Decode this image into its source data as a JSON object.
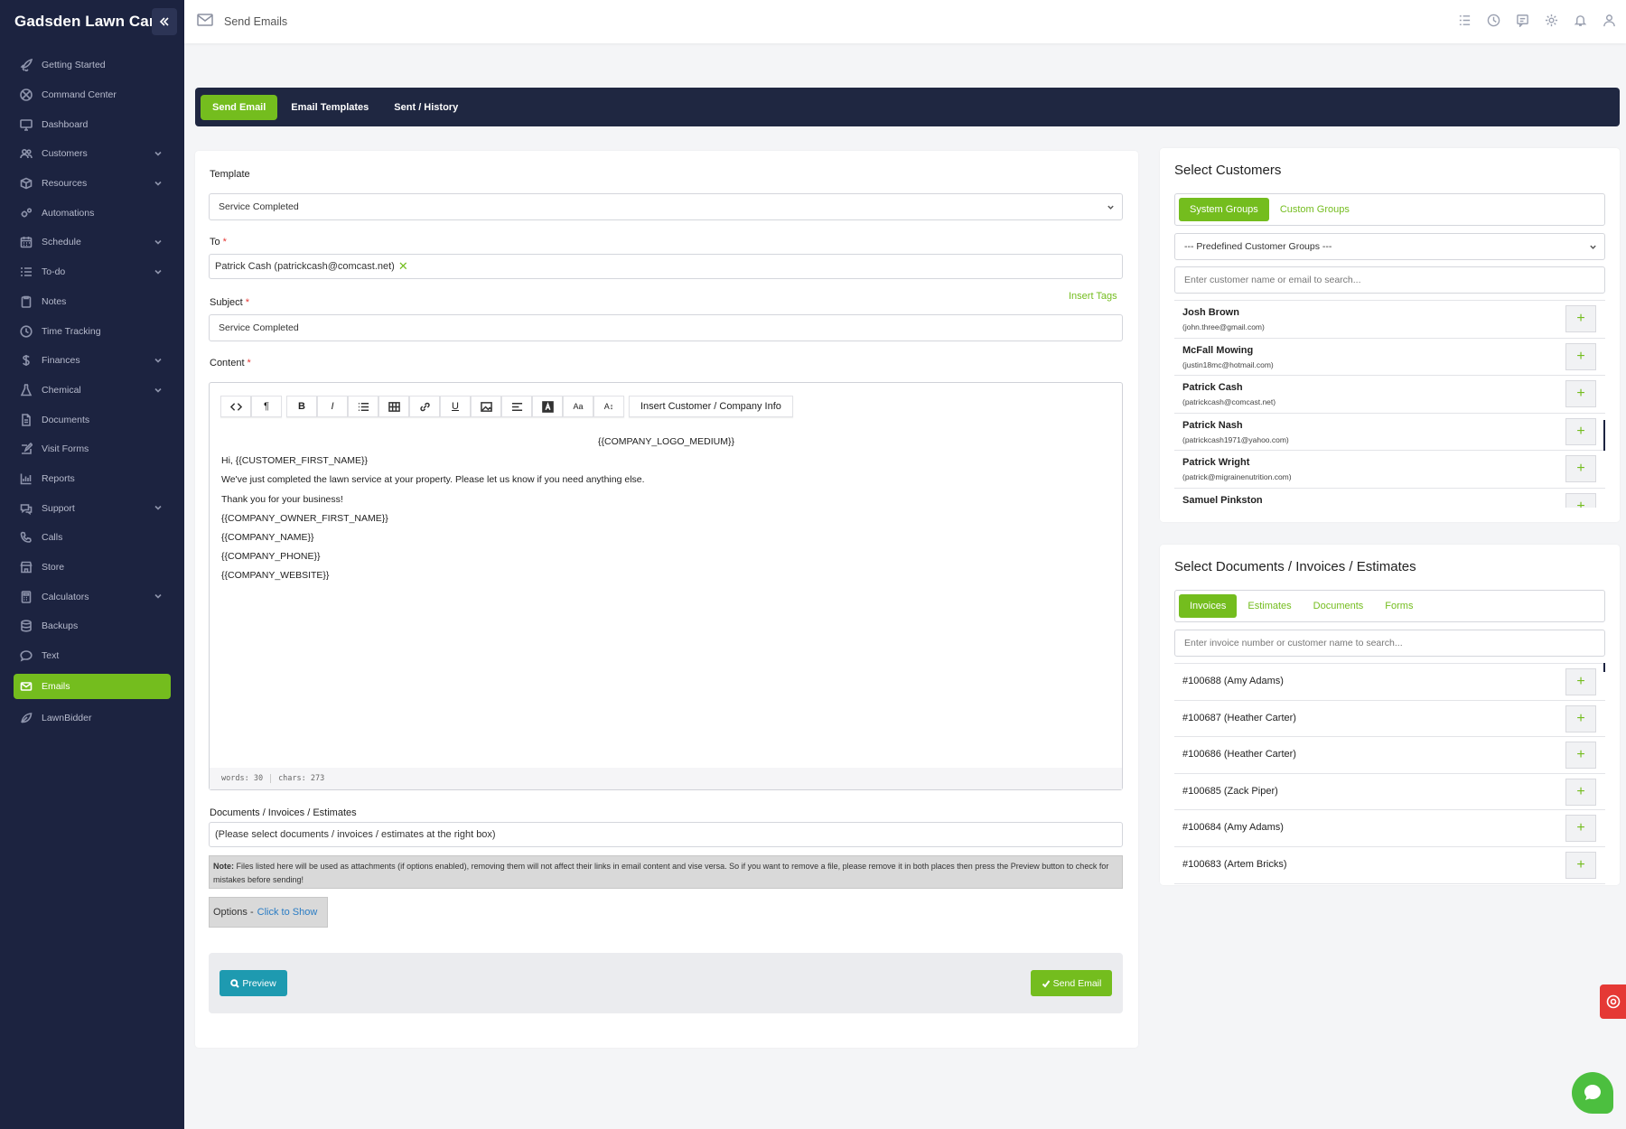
{
  "brand": "Gadsden Lawn Care",
  "topbar": {
    "title": "Send Emails"
  },
  "sidebar": {
    "items": [
      {
        "label": "Getting Started",
        "icon": "rocket-icon",
        "chevron": false
      },
      {
        "label": "Command Center",
        "icon": "target-icon",
        "chevron": false
      },
      {
        "label": "Dashboard",
        "icon": "monitor-icon",
        "chevron": false
      },
      {
        "label": "Customers",
        "icon": "users-icon",
        "chevron": true
      },
      {
        "label": "Resources",
        "icon": "box-icon",
        "chevron": true
      },
      {
        "label": "Automations",
        "icon": "gears-icon",
        "chevron": false
      },
      {
        "label": "Schedule",
        "icon": "calendar-icon",
        "chevron": true
      },
      {
        "label": "To-do",
        "icon": "list-icon",
        "chevron": true
      },
      {
        "label": "Notes",
        "icon": "clipboard-icon",
        "chevron": false
      },
      {
        "label": "Time Tracking",
        "icon": "clock-icon",
        "chevron": false
      },
      {
        "label": "Finances",
        "icon": "dollar-icon",
        "chevron": true
      },
      {
        "label": "Chemical",
        "icon": "flask-icon",
        "chevron": true
      },
      {
        "label": "Documents",
        "icon": "document-icon",
        "chevron": false
      },
      {
        "label": "Visit Forms",
        "icon": "edit-icon",
        "chevron": false
      },
      {
        "label": "Reports",
        "icon": "chart-icon",
        "chevron": false
      },
      {
        "label": "Support",
        "icon": "chat-icon",
        "chevron": true
      },
      {
        "label": "Calls",
        "icon": "phone-icon",
        "chevron": false
      },
      {
        "label": "Store",
        "icon": "store-icon",
        "chevron": false
      },
      {
        "label": "Calculators",
        "icon": "calculator-icon",
        "chevron": true
      },
      {
        "label": "Backups",
        "icon": "database-icon",
        "chevron": false
      },
      {
        "label": "Text",
        "icon": "message-icon",
        "chevron": false
      },
      {
        "label": "Emails",
        "icon": "mail-icon",
        "chevron": false,
        "active": true
      },
      {
        "label": "LawnBidder",
        "icon": "leaf-icon",
        "chevron": false
      }
    ]
  },
  "tabs": [
    {
      "label": "Send Email",
      "active": true
    },
    {
      "label": "Email Templates",
      "active": false
    },
    {
      "label": "Sent / History",
      "active": false
    }
  ],
  "form": {
    "template_label": "Template",
    "template_value": "Service Completed",
    "to_label": "To",
    "to_value": "Patrick Cash (patrickcash@comcast.net)",
    "to_remove": "✕",
    "insert_tags": "Insert Tags",
    "subject_label": "Subject",
    "subject_value": "Service Completed",
    "content_label": "Content",
    "required_mark": "*",
    "toolbar": {
      "insert_info": "Insert Customer / Company Info",
      "paragraph": "¶",
      "bold": "B",
      "italic": "I",
      "underline": "U",
      "font_size": "Aa",
      "line_height": "A↕"
    },
    "content_lines": [
      "{{COMPANY_LOGO_MEDIUM}}",
      "Hi, {{CUSTOMER_FIRST_NAME}}",
      "We've just completed the lawn service at your property. Please let us know if you need anything else.",
      "Thank you for your business!",
      "{{COMPANY_OWNER_FIRST_NAME}}",
      "{{COMPANY_NAME}}",
      "{{COMPANY_PHONE}}",
      "{{COMPANY_WEBSITE}}"
    ],
    "words": "words: 30",
    "chars": "chars: 273",
    "docs_label": "Documents / Invoices / Estimates",
    "docs_value": "(Please select documents / invoices / estimates at the right box)",
    "note_bold": "Note:",
    "note_text": " Files listed here will be used as attachments (if options enabled), removing them will not affect their links in email content and vise versa. So if you want to remove a file, please remove it in both places then press the Preview button to check for mistakes before sending!",
    "options_label": "Options -",
    "options_link": "Click to Show",
    "preview_button": "Preview",
    "send_button": "Send Email"
  },
  "customers": {
    "title": "Select Customers",
    "tabs": [
      {
        "label": "System Groups",
        "active": true
      },
      {
        "label": "Custom Groups",
        "active": false
      }
    ],
    "group_select": "--- Predefined Customer Groups ---",
    "search_placeholder": "Enter customer name or email to search...",
    "list": [
      {
        "name": "Josh Brown",
        "email": "(john.three@gmail.com)"
      },
      {
        "name": "McFall Mowing",
        "email": "(justin18mc@hotmail.com)"
      },
      {
        "name": "Patrick Cash",
        "email": "(patrickcash@comcast.net)"
      },
      {
        "name": "Patrick Nash",
        "email": "(patrickcash1971@yahoo.com)"
      },
      {
        "name": "Patrick Wright",
        "email": "(patrick@migrainenutrition.com)"
      },
      {
        "name": "Samuel Pinkston",
        "email": ""
      }
    ]
  },
  "documents": {
    "title": "Select Documents / Invoices / Estimates",
    "tabs": [
      {
        "label": "Invoices",
        "active": true
      },
      {
        "label": "Estimates",
        "active": false
      },
      {
        "label": "Documents",
        "active": false
      },
      {
        "label": "Forms",
        "active": false
      }
    ],
    "search_placeholder": "Enter invoice number or customer name to search...",
    "list": [
      "#100688 (Amy Adams)",
      "#100687 (Heather Carter)",
      "#100686 (Heather Carter)",
      "#100685 (Zack Piper)",
      "#100684 (Amy Adams)",
      "#100683 (Artem Bricks)"
    ]
  },
  "plus": "+",
  "colors": {
    "accent": "#74bd1e",
    "sidebar": "#1c2340",
    "preview": "#1e9ab0",
    "danger": "#e53935"
  }
}
